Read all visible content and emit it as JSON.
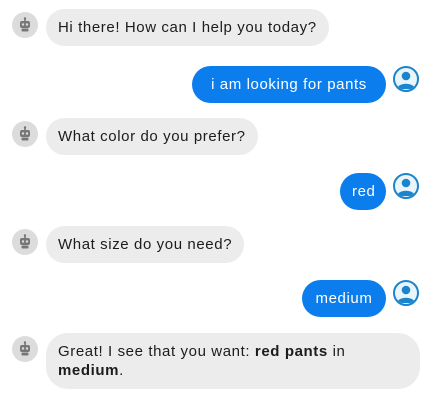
{
  "messages": [
    {
      "from": "bot",
      "text": "Hi there! How can I help you today?"
    },
    {
      "from": "user",
      "text": "i am looking for pants"
    },
    {
      "from": "bot",
      "text": "What color do you prefer?"
    },
    {
      "from": "user",
      "text": "red"
    },
    {
      "from": "bot",
      "text": "What size do you need?"
    },
    {
      "from": "user",
      "text": "medium"
    },
    {
      "from": "bot",
      "text_prefix": "Great! I see that you want: ",
      "bold_1": "red pants",
      "text_middle": " in ",
      "bold_2": "medium",
      "text_suffix": "."
    }
  ],
  "colors": {
    "user_bubble": "#0b7ded",
    "bot_bubble": "#ececec",
    "user_avatar_ring": "#1a84cc",
    "bot_avatar_bg": "#dcdcdc"
  },
  "icons": {
    "bot": "robot-icon",
    "user": "user-icon"
  }
}
